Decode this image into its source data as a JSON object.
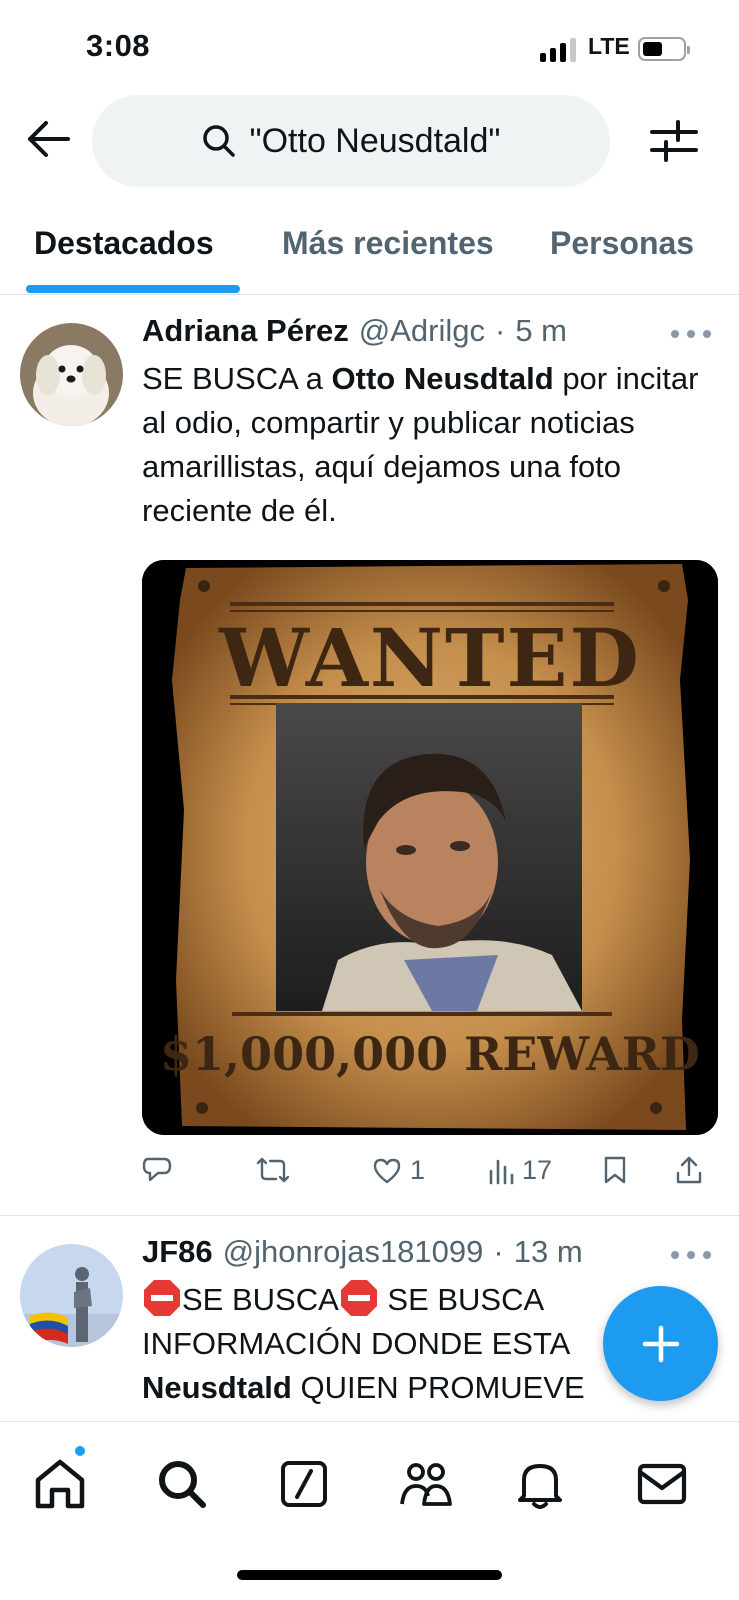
{
  "status_bar": {
    "time": "3:08",
    "network": "LTE"
  },
  "search": {
    "query": "\"Otto Neusdtald\""
  },
  "tabs": [
    {
      "label": "Destacados",
      "active": true
    },
    {
      "label": "Más recientes",
      "active": false
    },
    {
      "label": "Personas",
      "active": false
    }
  ],
  "tweets": [
    {
      "name": "Adriana Pérez",
      "handle": "@Adrilgc",
      "sep": "·",
      "ago": "5 m",
      "text_pre": "SE BUSCA a ",
      "text_bold": "Otto Neusdtald",
      "text_post": " por incitar al odio, compartir y publicar noticias amarillistas, aquí dejamos una foto reciente de él.",
      "media": {
        "headline": "WANTED",
        "reward": "$1,000,000 REWARD"
      },
      "stats": {
        "replies": "",
        "retweets": "",
        "likes": "1",
        "views": "17"
      }
    },
    {
      "name": "JF86",
      "handle": "@jhonrojas181099",
      "sep": "·",
      "ago": "13 m",
      "text_line1": "SE BUSCA",
      "text_line1b": " SE BUSCA",
      "text_line2": "INFORMACIÓN DONDE ESTA",
      "text_bold": "Neusdtald",
      "text_line3": " QUIEN PROMUEVE EL"
    }
  ],
  "icons": {
    "back": "arrow-left-icon",
    "search": "search-icon",
    "filter": "sliders-icon",
    "more": "more-dots-icon",
    "reply": "reply-icon",
    "retweet": "retweet-icon",
    "like": "heart-icon",
    "views": "views-icon",
    "bookmark": "bookmark-icon",
    "share": "share-icon",
    "compose": "plus-icon",
    "nav": [
      "home-icon",
      "search-icon",
      "grok-icon",
      "communities-icon",
      "bell-icon",
      "mail-icon"
    ]
  },
  "colors": {
    "accent": "#1d9bf0",
    "text": "#0f1419",
    "muted": "#536471",
    "pill": "#eff3f4"
  }
}
